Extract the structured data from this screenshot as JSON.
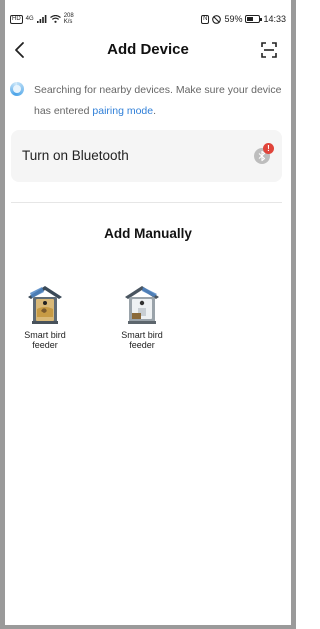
{
  "status_bar": {
    "left_box": "HD",
    "signal_text": "4G",
    "speed_value": "208",
    "speed_unit": "K/s",
    "nfc_text": "N",
    "battery_percent": "59%",
    "battery_level": 0.59,
    "time": "14:33"
  },
  "header": {
    "title": "Add Device",
    "back_icon": "chevron-left-icon",
    "scan_icon": "scan-icon"
  },
  "search": {
    "text": "Searching for nearby devices. Make sure your device has entered ",
    "link": "pairing mode",
    "suffix": "."
  },
  "bluetooth": {
    "label": "Turn on Bluetooth",
    "badge": "!"
  },
  "manual": {
    "title": "Add Manually",
    "devices": [
      {
        "label": "Smart bird feeder",
        "icon": "bird-feeder-icon"
      },
      {
        "label": "Smart bird feeder",
        "icon": "bird-feeder-icon"
      }
    ]
  },
  "colors": {
    "accent": "#2f7fd8",
    "badge": "#e0443a",
    "card_bg": "#f5f5f5"
  }
}
